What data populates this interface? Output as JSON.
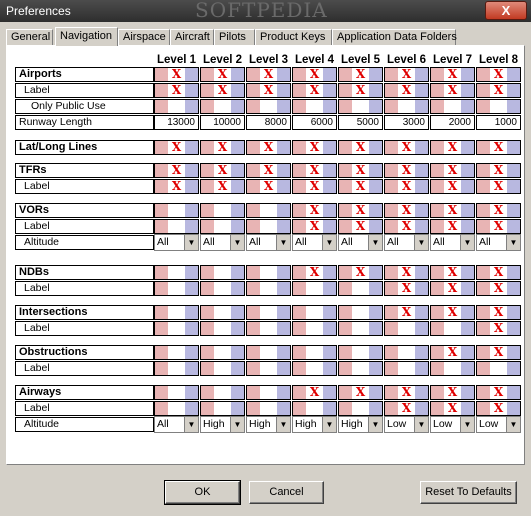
{
  "window": {
    "title": "Preferences",
    "close_label": "X",
    "watermark": "SOFTPEDIA"
  },
  "tabs": [
    {
      "label": "General",
      "active": false
    },
    {
      "label": "Navigation",
      "active": true
    },
    {
      "label": "Airspace",
      "active": false
    },
    {
      "label": "Aircraft",
      "active": false
    },
    {
      "label": "Pilots",
      "active": false
    },
    {
      "label": "Product Keys",
      "active": false
    },
    {
      "label": "Application Data Folders",
      "active": false
    }
  ],
  "levels": [
    "Level 1",
    "Level 2",
    "Level 3",
    "Level 4",
    "Level 5",
    "Level 6",
    "Level 7",
    "Level 8"
  ],
  "colors": {
    "pink": "#e8b4b4",
    "lavender": "#b8b8e0",
    "x": "#e00000"
  },
  "groups": [
    {
      "name": "Airports",
      "rows": [
        {
          "label": "Airports",
          "type": "check",
          "header": true,
          "values": [
            1,
            1,
            1,
            1,
            1,
            1,
            1,
            1
          ]
        },
        {
          "label": "Label",
          "type": "check",
          "indent": 1,
          "values": [
            1,
            1,
            1,
            1,
            1,
            1,
            1,
            1
          ]
        },
        {
          "label": "Only Public Use",
          "type": "check",
          "indent": 2,
          "values": [
            0,
            0,
            0,
            0,
            0,
            0,
            0,
            0
          ]
        },
        {
          "label": "Runway Length",
          "type": "number",
          "values": [
            "13000",
            "10000",
            "8000",
            "6000",
            "5000",
            "3000",
            "2000",
            "1000"
          ]
        }
      ]
    },
    {
      "name": "Lat/Long Lines",
      "rows": [
        {
          "label": "Lat/Long Lines",
          "type": "check",
          "header": true,
          "values": [
            1,
            1,
            1,
            1,
            1,
            1,
            1,
            1
          ]
        }
      ]
    },
    {
      "name": "TFRs",
      "rows": [
        {
          "label": "TFRs",
          "type": "check",
          "header": true,
          "values": [
            1,
            1,
            1,
            1,
            1,
            1,
            1,
            1
          ]
        },
        {
          "label": "Label",
          "type": "check",
          "indent": 1,
          "values": [
            1,
            1,
            1,
            1,
            1,
            1,
            1,
            1
          ]
        }
      ]
    },
    {
      "name": "VORs",
      "rows": [
        {
          "label": "VORs",
          "type": "check",
          "header": true,
          "values": [
            0,
            0,
            0,
            1,
            1,
            1,
            1,
            1
          ]
        },
        {
          "label": "Label",
          "type": "check",
          "indent": 1,
          "values": [
            0,
            0,
            0,
            1,
            1,
            1,
            1,
            1
          ]
        },
        {
          "label": "Altitude",
          "type": "select",
          "indent": 1,
          "values": [
            "All",
            "All",
            "All",
            "All",
            "All",
            "All",
            "All",
            "All"
          ]
        }
      ]
    },
    {
      "name": "NDBs",
      "rows": [
        {
          "label": "NDBs",
          "type": "check",
          "header": true,
          "values": [
            0,
            0,
            0,
            1,
            1,
            1,
            1,
            1
          ]
        },
        {
          "label": "Label",
          "type": "check",
          "indent": 1,
          "values": [
            0,
            0,
            0,
            0,
            0,
            1,
            1,
            1
          ]
        }
      ]
    },
    {
      "name": "Intersections",
      "rows": [
        {
          "label": "Intersections",
          "type": "check",
          "header": true,
          "values": [
            0,
            0,
            0,
            0,
            0,
            1,
            1,
            1
          ]
        },
        {
          "label": "Label",
          "type": "check",
          "indent": 1,
          "values": [
            0,
            0,
            0,
            0,
            0,
            0,
            0,
            1
          ]
        }
      ]
    },
    {
      "name": "Obstructions",
      "rows": [
        {
          "label": "Obstructions",
          "type": "check",
          "header": true,
          "values": [
            0,
            0,
            0,
            0,
            0,
            0,
            1,
            1
          ]
        },
        {
          "label": "Label",
          "type": "check",
          "indent": 1,
          "values": [
            0,
            0,
            0,
            0,
            0,
            0,
            0,
            0
          ]
        }
      ]
    },
    {
      "name": "Airways",
      "rows": [
        {
          "label": "Airways",
          "type": "check",
          "header": true,
          "values": [
            0,
            0,
            0,
            1,
            1,
            1,
            1,
            1
          ]
        },
        {
          "label": "Label",
          "type": "check",
          "indent": 1,
          "values": [
            0,
            0,
            0,
            0,
            0,
            1,
            1,
            1
          ]
        },
        {
          "label": "Altitude",
          "type": "select",
          "indent": 1,
          "values": [
            "All",
            "High",
            "High",
            "High",
            "High",
            "Low",
            "Low",
            "Low"
          ]
        }
      ]
    }
  ],
  "buttons": {
    "ok": "OK",
    "cancel": "Cancel",
    "reset": "Reset To Defaults"
  }
}
